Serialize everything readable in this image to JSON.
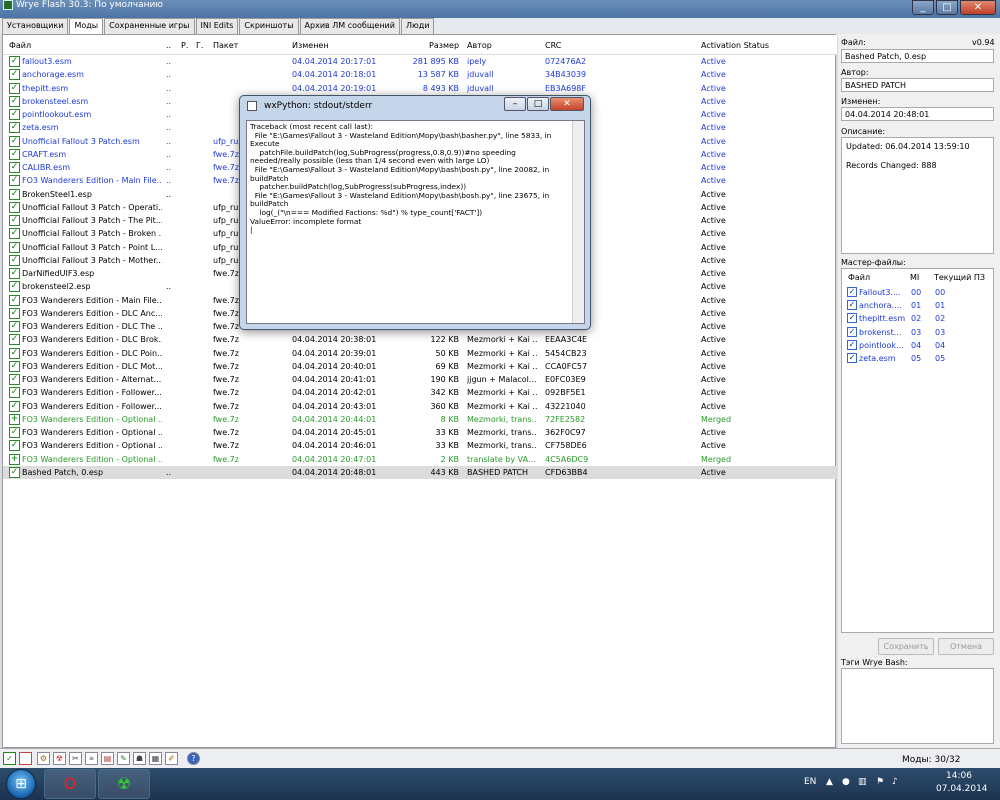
{
  "window": {
    "title": "Wrye Flash 30.3: По умолчанию",
    "minimize": "_",
    "maximize": "□",
    "close": "✕"
  },
  "tabs": [
    {
      "label": "Установщики",
      "active": false
    },
    {
      "label": "Моды",
      "active": true
    },
    {
      "label": "Сохраненные игры",
      "active": false
    },
    {
      "label": "INI Edits",
      "active": false
    },
    {
      "label": "Скриншоты",
      "active": false
    },
    {
      "label": "Архив ЛМ сообщений",
      "active": false
    },
    {
      "label": "Люди",
      "active": false
    }
  ],
  "table": {
    "headers": {
      "file": "Файл",
      "dots": "..",
      "r": "Р.",
      "g": "Г.",
      "package": "Пакет",
      "modified": "Изменен",
      "size": "Размер",
      "author": "Автор",
      "crc": "CRC",
      "status": "Activation Status"
    },
    "rows": [
      {
        "check": "✓",
        "file": "fallout3.esm",
        "dots": "..",
        "package": "",
        "modified": "04.04.2014 20:17:01",
        "size": "281 895 KB",
        "author": "ipely",
        "crc": "072476A2",
        "status": "Active",
        "color": "blue"
      },
      {
        "check": "✓",
        "file": "anchorage.esm",
        "dots": "..",
        "package": "",
        "modified": "04.04.2014 20:18:01",
        "size": "13 587 KB",
        "author": "jduvall",
        "crc": "34B43039",
        "status": "Active",
        "color": "blue"
      },
      {
        "check": "✓",
        "file": "thepitt.esm",
        "dots": "..",
        "package": "",
        "modified": "04.04.2014 20:19:01",
        "size": "8 493 KB",
        "author": "jduvall",
        "crc": "EB3A698F",
        "status": "Active",
        "color": "blue"
      },
      {
        "check": "✓",
        "file": "brokensteel.esm",
        "dots": "..",
        "package": "",
        "modified": "",
        "size": "",
        "author": "",
        "crc": "",
        "status": "Active",
        "color": "blue"
      },
      {
        "check": "✓",
        "file": "pointlookout.esm",
        "dots": "..",
        "package": "",
        "modified": "",
        "size": "",
        "author": "",
        "crc": "",
        "status": "Active",
        "color": "blue"
      },
      {
        "check": "✓",
        "file": "zeta.esm",
        "dots": "..",
        "package": "",
        "modified": "",
        "size": "",
        "author": "",
        "crc": "",
        "status": "Active",
        "color": "blue"
      },
      {
        "check": "✓",
        "file": "Unofficial Fallout 3 Patch.esm",
        "dots": "..",
        "package": "ufp_rus",
        "modified": "",
        "size": "",
        "author": "",
        "crc": "",
        "status": "Active",
        "color": "blue"
      },
      {
        "check": "✓",
        "file": "CRAFT.esm",
        "dots": "..",
        "package": "fwe.7z",
        "modified": "",
        "size": "",
        "author": "",
        "crc": "",
        "status": "Active",
        "color": "blue"
      },
      {
        "check": "✓",
        "file": "CALIBR.esm",
        "dots": "..",
        "package": "fwe.7z",
        "modified": "",
        "size": "",
        "author": "",
        "crc": "",
        "status": "Active",
        "color": "blue"
      },
      {
        "check": "✓",
        "file": "FO3 Wanderers Edition - Main File...",
        "dots": "..",
        "package": "fwe.7z",
        "modified": "",
        "size": "",
        "author": "",
        "crc": "",
        "status": "Active",
        "color": "blue"
      },
      {
        "check": "✓",
        "file": "BrokenSteel1.esp",
        "dots": "..",
        "package": "",
        "modified": "",
        "size": "",
        "author": "",
        "crc": "",
        "status": "Active",
        "color": "black"
      },
      {
        "check": "✓",
        "file": "Unofficial Fallout 3 Patch - Operati...",
        "dots": "",
        "package": "ufp_rus",
        "modified": "",
        "size": "",
        "author": "",
        "crc": "",
        "status": "Active",
        "color": "black"
      },
      {
        "check": "✓",
        "file": "Unofficial Fallout 3 Patch - The Pit...",
        "dots": "",
        "package": "ufp_rus",
        "modified": "",
        "size": "",
        "author": "",
        "crc": "",
        "status": "Active",
        "color": "black"
      },
      {
        "check": "✓",
        "file": "Unofficial Fallout 3 Patch - Broken ...",
        "dots": "",
        "package": "ufp_rus",
        "modified": "",
        "size": "",
        "author": "",
        "crc": "",
        "status": "Active",
        "color": "black"
      },
      {
        "check": "✓",
        "file": "Unofficial Fallout 3 Patch - Point L...",
        "dots": "",
        "package": "ufp_rus",
        "modified": "",
        "size": "",
        "author": "",
        "crc": "",
        "status": "Active",
        "color": "black"
      },
      {
        "check": "✓",
        "file": "Unofficial Fallout 3 Patch - Mother...",
        "dots": "",
        "package": "ufp_rus",
        "modified": "",
        "size": "",
        "author": "",
        "crc": "",
        "status": "Active",
        "color": "black"
      },
      {
        "check": "✓",
        "file": "DarNifiedUIF3.esp",
        "dots": "",
        "package": "fwe.7z",
        "modified": "",
        "size": "",
        "author": "",
        "crc": "",
        "status": "Active",
        "color": "black"
      },
      {
        "check": "✓",
        "file": "brokensteel2.esp",
        "dots": "..",
        "package": "",
        "modified": "",
        "size": "",
        "author": "",
        "crc": "",
        "status": "Active",
        "color": "black"
      },
      {
        "check": "✓",
        "file": "FO3 Wanderers Edition - Main File...",
        "dots": "",
        "package": "fwe.7z",
        "modified": "",
        "size": "",
        "author": "",
        "crc": "",
        "status": "Active",
        "color": "black"
      },
      {
        "check": "✓",
        "file": "FO3 Wanderers Edition - DLC Anc...",
        "dots": "",
        "package": "fwe.7z",
        "modified": "",
        "size": "",
        "author": "",
        "crc": "",
        "status": "Active",
        "color": "black"
      },
      {
        "check": "✓",
        "file": "FO3 Wanderers Edition - DLC The ...",
        "dots": "",
        "package": "fwe.7z",
        "modified": "",
        "size": "",
        "author": "",
        "crc": "",
        "status": "Active",
        "color": "black"
      },
      {
        "check": "✓",
        "file": "FO3 Wanderers Edition - DLC Brok...",
        "dots": "",
        "package": "fwe.7z",
        "modified": "04.04.2014 20:38:01",
        "size": "122 KB",
        "author": "Mezmorki + Kai ...",
        "crc": "EEAA3C4E",
        "status": "Active",
        "color": "black"
      },
      {
        "check": "✓",
        "file": "FO3 Wanderers Edition - DLC Poin...",
        "dots": "",
        "package": "fwe.7z",
        "modified": "04.04.2014 20:39:01",
        "size": "50 KB",
        "author": "Mezmorki + Kai ...",
        "crc": "5454CB23",
        "status": "Active",
        "color": "black"
      },
      {
        "check": "✓",
        "file": "FO3 Wanderers Edition - DLC Mot...",
        "dots": "",
        "package": "fwe.7z",
        "modified": "04.04.2014 20:40:01",
        "size": "69 KB",
        "author": "Mezmorki + Kai ...",
        "crc": "CCA0FC57",
        "status": "Active",
        "color": "black"
      },
      {
        "check": "✓",
        "file": "FO3 Wanderers Edition - Alternat...",
        "dots": "",
        "package": "fwe.7z",
        "modified": "04.04.2014 20:41:01",
        "size": "190 KB",
        "author": "jjgun + Malacol...",
        "crc": "E0FC03E9",
        "status": "Active",
        "color": "black"
      },
      {
        "check": "✓",
        "file": "FO3 Wanderers Edition - Follower...",
        "dots": "",
        "package": "fwe.7z",
        "modified": "04.04.2014 20:42:01",
        "size": "342 KB",
        "author": "Mezmorki + Kai ...",
        "crc": "092BF5E1",
        "status": "Active",
        "color": "black"
      },
      {
        "check": "✓",
        "file": "FO3 Wanderers Edition - Follower...",
        "dots": "",
        "package": "fwe.7z",
        "modified": "04.04.2014 20:43:01",
        "size": "360 KB",
        "author": "Mezmorki + Kai ...",
        "crc": "43221040",
        "status": "Active",
        "color": "black"
      },
      {
        "check": "+",
        "file": "FO3 Wanderers Edition - Optional ...",
        "dots": "",
        "package": "fwe.7z",
        "modified": "04.04.2014 20:44:01",
        "size": "8 KB",
        "author": "Mezmorki, trans...",
        "crc": "72FE2582",
        "status": "Merged",
        "color": "green"
      },
      {
        "check": "✓",
        "file": "FO3 Wanderers Edition - Optional ...",
        "dots": "",
        "package": "fwe.7z",
        "modified": "04.04.2014 20:45:01",
        "size": "33 KB",
        "author": "Mezmorki, trans...",
        "crc": "362F0C97",
        "status": "Active",
        "color": "black"
      },
      {
        "check": "✓",
        "file": "FO3 Wanderers Edition - Optional ...",
        "dots": "",
        "package": "fwe.7z",
        "modified": "04.04.2014 20:46:01",
        "size": "33 KB",
        "author": "Mezmorki, trans...",
        "crc": "CF758DE6",
        "status": "Active",
        "color": "black"
      },
      {
        "check": "+",
        "file": "FO3 Wanderers Edition - Optional ...",
        "dots": "",
        "package": "fwe.7z",
        "modified": "04.04.2014 20:47:01",
        "size": "2 KB",
        "author": "translate by VA...",
        "crc": "4C5A6DC9",
        "status": "Merged",
        "color": "green"
      },
      {
        "check": "✓",
        "file": "Bashed Patch, 0.esp",
        "dots": "..",
        "package": "",
        "modified": "04.04.2014 20:48:01",
        "size": "443 KB",
        "author": "BASHED PATCH",
        "crc": "CFD63BB4",
        "status": "Active",
        "color": "black",
        "selected": true
      }
    ]
  },
  "dialog": {
    "title": "wxPython: stdout/stderr",
    "minimize": "–",
    "maximize": "□",
    "close": "✕",
    "text": "Traceback (most recent call last):\n  File \"E:\\Games\\Fallout 3 - Wasteland Edition\\Mopy\\bash\\basher.py\", line 5833, in\nExecute\n    patchFile.buildPatch(log,SubProgress(progress,0.8,0.9))#no speeding\nneeded/really possible (less than 1/4 second even with large LO)\n  File \"E:\\Games\\Fallout 3 - Wasteland Edition\\Mopy\\bash\\bosh.py\", line 20082, in\nbuildPatch\n    patcher.buildPatch(log,SubProgress(subProgress,index))\n  File \"E:\\Games\\Fallout 3 - Wasteland Edition\\Mopy\\bash\\bosh.py\", line 23675, in\nbuildPatch\n    log(_(\"\\n=== Modified Factions: %d\") % type_count['FACT'])\nValueError: incomplete format\n|"
  },
  "details": {
    "file_label": "Файл:",
    "version": "v0.94",
    "file_value": "Bashed Patch, 0.esp",
    "author_label": "Автор:",
    "author_value": "BASHED PATCH",
    "modified_label": "Изменен:",
    "modified_value": "04.04.2014 20:48:01",
    "desc_label": "Описание:",
    "desc_line1": "Updated: 06.04.2014 13:59:10",
    "desc_line2": "Records Changed: 888",
    "masters_label": "Мастер-файлы:",
    "masters_headers": {
      "file": "Файл",
      "mi": "MI",
      "current": "Текущий ПЗ"
    },
    "masters": [
      {
        "check": "✓",
        "file": "Fallout3....",
        "mi": "00",
        "cur": "00"
      },
      {
        "check": "✓",
        "file": "anchora....",
        "mi": "01",
        "cur": "01"
      },
      {
        "check": "✓",
        "file": "thepitt.esm",
        "mi": "02",
        "cur": "02"
      },
      {
        "check": "✓",
        "file": "brokenst...",
        "mi": "03",
        "cur": "03"
      },
      {
        "check": "✓",
        "file": "pointlook...",
        "mi": "04",
        "cur": "04"
      },
      {
        "check": "✓",
        "file": "zeta.esm",
        "mi": "05",
        "cur": "05"
      }
    ],
    "save_button": "Сохранить",
    "cancel_button": "Отмена",
    "tags_label": "Тэги Wrye Bash:"
  },
  "statusbar": {
    "mods_count": "Моды: 30/32"
  },
  "taskbar": {
    "lang": "EN",
    "time": "14:06",
    "date": "07.04.2014"
  }
}
